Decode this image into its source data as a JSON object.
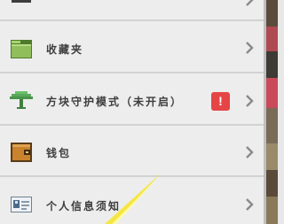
{
  "menu": {
    "items": [
      {
        "label": "",
        "icon": "partial-top-icon"
      },
      {
        "label": "收藏夹",
        "icon": "folder-icon"
      },
      {
        "label": "方块守护模式（未开启）",
        "icon": "tree-icon",
        "badge": "!"
      },
      {
        "label": "钱包",
        "icon": "wallet-icon"
      },
      {
        "label": "个人信息须知",
        "icon": "id-card-icon"
      }
    ]
  },
  "colors": {
    "background": "#ededed",
    "separator": "#d2d2d2",
    "warning": "#e54545",
    "folder": "#8fbe5b",
    "wallet": "#c9822e"
  }
}
